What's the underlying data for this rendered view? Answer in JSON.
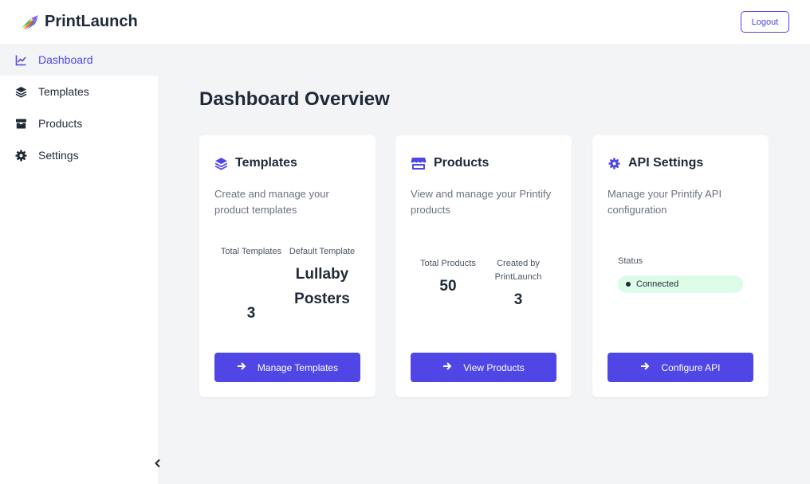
{
  "app": {
    "name": "PrintLaunch"
  },
  "header": {
    "logout_label": "Logout"
  },
  "sidebar": {
    "items": [
      {
        "label": "Dashboard",
        "icon": "chart-line-icon",
        "active": true
      },
      {
        "label": "Templates",
        "icon": "layers-icon"
      },
      {
        "label": "Products",
        "icon": "box-icon"
      },
      {
        "label": "Settings",
        "icon": "gear-icon"
      }
    ],
    "collapse_icon": "chevron-left-icon"
  },
  "main": {
    "title": "Dashboard Overview",
    "cards": {
      "templates": {
        "title": "Templates",
        "icon": "layers-icon",
        "description": "Create and manage your product templates",
        "stats": [
          {
            "label": "Total Templates",
            "value": "3"
          },
          {
            "label": "Default Template",
            "value": "Lullaby Posters"
          }
        ],
        "button_label": "Manage Templates"
      },
      "products": {
        "title": "Products",
        "icon": "store-icon",
        "description": "View and manage your Printify products",
        "stats": [
          {
            "label": "Total Products",
            "value": "50"
          },
          {
            "label": "Created by PrintLaunch",
            "value": "3"
          }
        ],
        "button_label": "View Products"
      },
      "api": {
        "title": "API Settings",
        "icon": "gear-icon",
        "description": "Manage your Printify API configuration",
        "status_label": "Status",
        "status_value": "Connected",
        "button_label": "Configure API"
      }
    }
  },
  "colors": {
    "accent": "#4f46e5",
    "background": "#f3f4f6",
    "status_connected_bg": "#dcfce7"
  }
}
